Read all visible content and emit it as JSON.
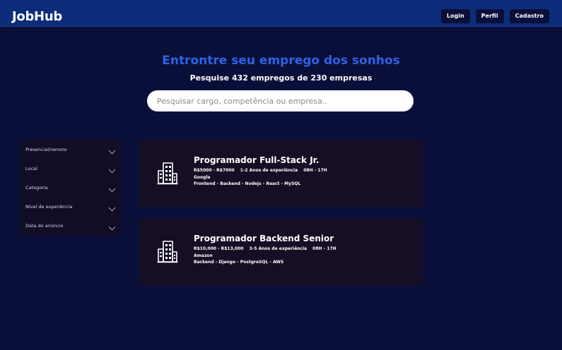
{
  "header": {
    "logo": "JobHub",
    "nav": [
      {
        "label": "Login"
      },
      {
        "label": "Perfil"
      },
      {
        "label": "Cadastro"
      }
    ]
  },
  "hero": {
    "title": "Entrontre seu emprego dos sonhos",
    "subtitle": "Pesquise 432 empregos de 230 empresas"
  },
  "search": {
    "placeholder": "Pesquisar cargo, competência ou empresa.."
  },
  "filters": [
    {
      "label": "Presencial/remoto",
      "icon": "chevron-down-icon"
    },
    {
      "label": "Local",
      "icon": "chevron-down-icon"
    },
    {
      "label": "Categoria",
      "icon": "chevron-down-icon"
    },
    {
      "label": "Nível de experiência",
      "icon": "chevron-down-icon"
    },
    {
      "label": "Data do anúncio",
      "icon": "chevron-down-icon"
    }
  ],
  "jobs": [
    {
      "title": "Programador Full-Stack Jr.",
      "salary": "R$5000 - R$7000",
      "experience": "1-2 Anos de experiência",
      "hours": "08H - 17H",
      "company": "Google",
      "tags": "Frontend - Backend - Nodejs - React - MySQL",
      "icon": "building-icon"
    },
    {
      "title": "Programador Backend Senior",
      "salary": "R$10,000 - R$13,000",
      "experience": "3-5 Anos de experiência",
      "hours": "08H - 17H",
      "company": "Amazon",
      "tags": "Backend - Django - PostgreSQL - AWS",
      "icon": "building-icon"
    }
  ],
  "colors": {
    "background": "#0a0f3a",
    "header": "#0d2d7a",
    "accent": "#2f63e3",
    "card": "#150e24"
  }
}
